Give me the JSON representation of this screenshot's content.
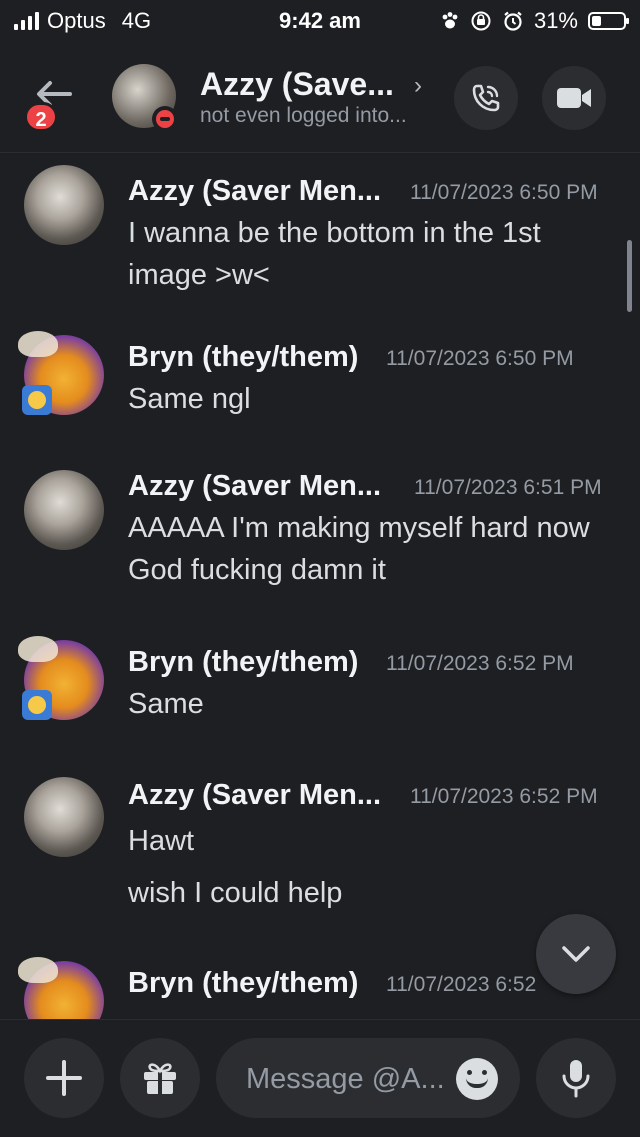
{
  "status_bar": {
    "carrier": "Optus",
    "network": "4G",
    "time": "9:42 am",
    "battery_percent": "31%",
    "battery_level": 0.31,
    "icons": [
      "signal-icon",
      "paw-icon",
      "orientation-lock-icon",
      "alarm-icon",
      "battery-icon"
    ]
  },
  "header": {
    "unread_count": "2",
    "name": "Azzy (Save...",
    "chevron": "›",
    "subtitle": "not even logged into...",
    "status": "do-not-disturb"
  },
  "messages": [
    {
      "author": "Azzy (Saver Men...",
      "timestamp": "11/07/2023 6:50 PM",
      "lines": [
        "I wanna be the bottom in the 1st image >w<"
      ]
    },
    {
      "author": "Bryn (they/them)",
      "timestamp": "11/07/2023 6:50 PM",
      "lines": [
        "Same ngl"
      ]
    },
    {
      "author": "Azzy (Saver Men...",
      "timestamp": "11/07/2023 6:51 PM",
      "lines": [
        "AAAAA I'm making myself hard now God fucking damn it"
      ]
    },
    {
      "author": "Bryn (they/them)",
      "timestamp": "11/07/2023 6:52 PM",
      "lines": [
        "Same"
      ]
    },
    {
      "author": "Azzy (Saver Men...",
      "timestamp": "11/07/2023 6:52 PM",
      "lines": [
        "Hawt",
        "wish I could help"
      ]
    },
    {
      "author": "Bryn (they/them)",
      "timestamp": "11/07/2023 6:52",
      "lines": []
    }
  ],
  "composer": {
    "placeholder": "Message @A..."
  },
  "colors": {
    "background": "#1e1f22",
    "surface": "#2b2d31",
    "badge_red": "#ed4245",
    "text": "#dbdee1",
    "muted": "#949ba4"
  }
}
